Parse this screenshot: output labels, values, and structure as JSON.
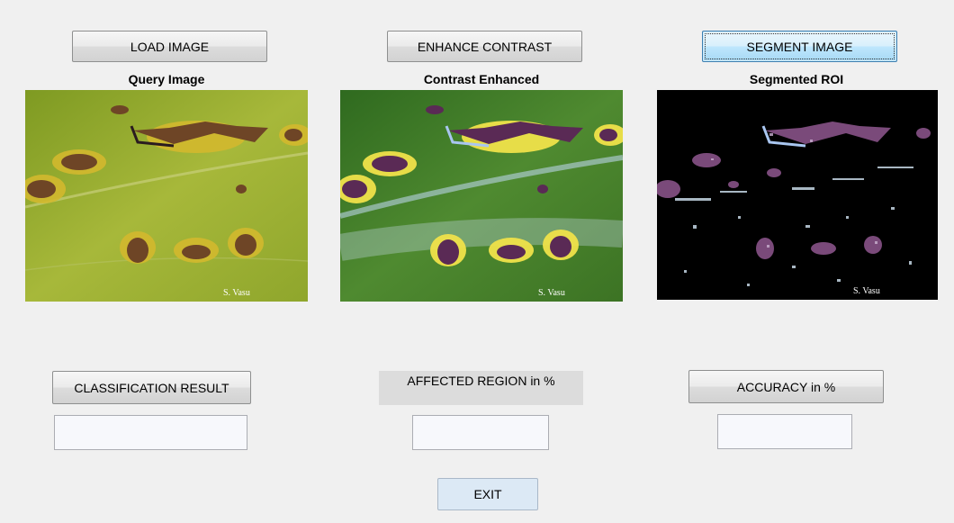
{
  "buttons": {
    "load_image": "LOAD IMAGE",
    "enhance_contrast": "ENHANCE CONTRAST",
    "segment_image": "SEGMENT IMAGE",
    "classification_result": "CLASSIFICATION RESULT",
    "accuracy": "ACCURACY in %",
    "exit": "EXIT"
  },
  "captions": {
    "query_image": "Query Image",
    "contrast_enhanced": "Contrast Enhanced",
    "segmented_roi": "Segmented ROI"
  },
  "labels": {
    "affected_region": "AFFECTED REGION in %"
  },
  "fields": {
    "classification_result_value": "",
    "affected_region_value": "",
    "accuracy_value": ""
  },
  "images": {
    "watermark": "S. Vasu"
  },
  "colors": {
    "leaf_green": "#8aa52e",
    "enhanced_green": "#3f7a25",
    "lesion_brown": "#6b3a2a",
    "lesion_purple": "#5a2d5a",
    "halo_yellow": "#d8c23a",
    "roi_background": "#000000",
    "active_button": "#bee6fd"
  }
}
